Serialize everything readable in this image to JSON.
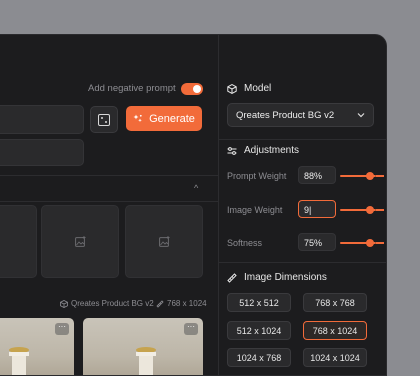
{
  "main": {
    "negative_prompt_label": "Add negative prompt",
    "negative_prompt_enabled": true,
    "generate_label": "Generate",
    "result_model": "Qreates Product BG v2",
    "result_size": "768 x 1024"
  },
  "sidebar": {
    "model_title": "Model",
    "model_value": "Qreates Product BG v2",
    "adjustments_title": "Adjustments",
    "adjustments": [
      {
        "label": "Prompt Weight",
        "value": "88%",
        "level": 0.88
      },
      {
        "label": "Image Weight",
        "value": "9|",
        "level": 0.9
      },
      {
        "label": "Softness",
        "value": "75%",
        "level": 0.75
      }
    ],
    "dimensions_title": "Image Dimensions",
    "dimensions": [
      "512 x 512",
      "768 x 768",
      "512 x 1024",
      "768 x 1024",
      "1024 x 768",
      "1024 x 1024"
    ],
    "selected_dimension": "768 x 1024"
  },
  "colors": {
    "accent": "#f26b3a",
    "panel": "#1c1c1e",
    "field": "#2a2a2c",
    "backdrop": "#8b8c91"
  }
}
